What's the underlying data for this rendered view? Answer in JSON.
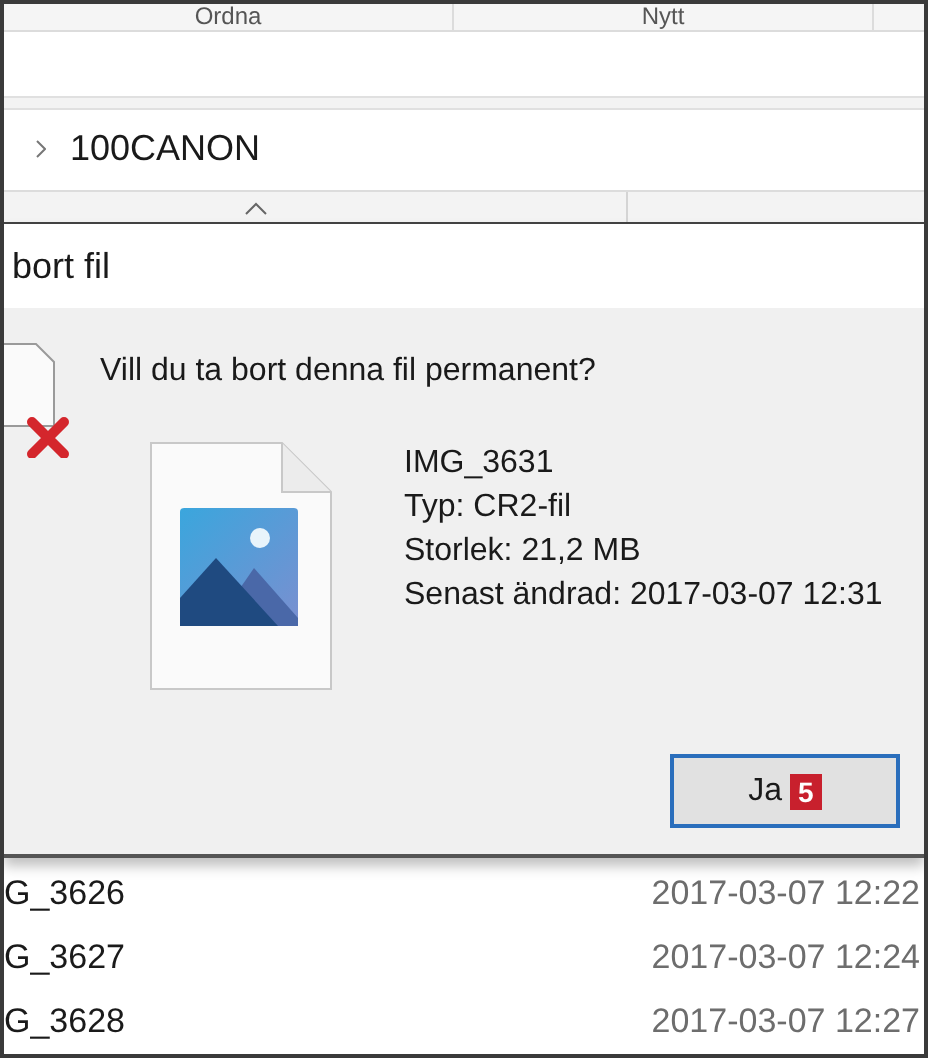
{
  "ribbon": {
    "tabs": [
      "Ordna",
      "Nytt"
    ]
  },
  "address_bar": {
    "crumb": "100CANON"
  },
  "dialog": {
    "title": "bort fil",
    "question": "Vill du ta bort denna fil permanent?",
    "file": {
      "name": "IMG_3631",
      "details": [
        "Typ: CR2-fil",
        "Storlek: 21,2 MB",
        "Senast ändrad: 2017-03-07 12:31"
      ]
    },
    "buttons": [
      {
        "label": "Ja",
        "badge": "5",
        "focused": true
      }
    ]
  },
  "files": [
    {
      "name": "G_3626",
      "date": "2017-03-07 12:22"
    },
    {
      "name": "G_3627",
      "date": "2017-03-07 12:24"
    },
    {
      "name": "G_3628",
      "date": "2017-03-07 12:27"
    }
  ]
}
